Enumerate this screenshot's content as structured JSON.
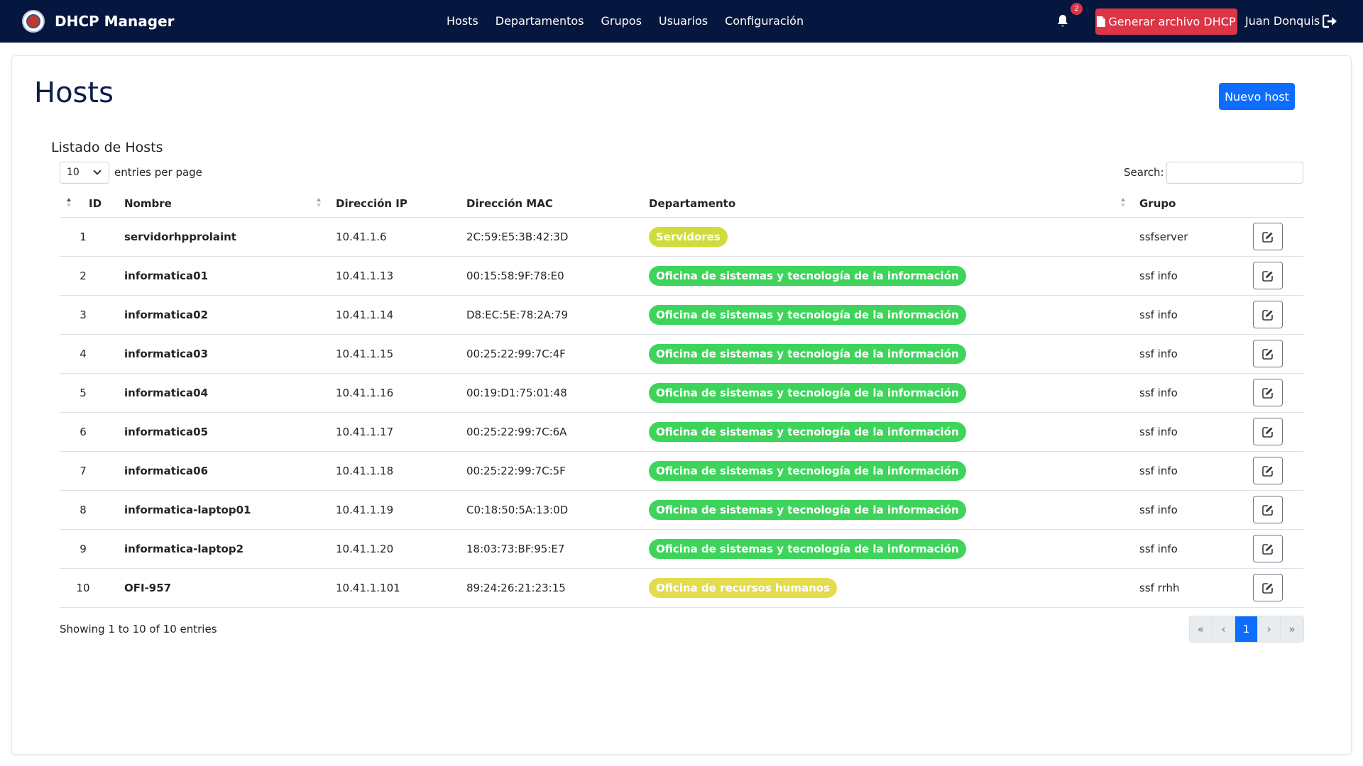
{
  "navbar": {
    "brand": "DHCP Manager",
    "links": [
      "Hosts",
      "Departamentos",
      "Grupos",
      "Usuarios",
      "Configuración"
    ],
    "notifications": "2",
    "generate_button": "Generar archivo DHCP",
    "user_name": "Juan Donquis"
  },
  "page": {
    "title": "Hosts",
    "new_host_button": "Nuevo host",
    "subtitle": "Listado de Hosts"
  },
  "table_controls": {
    "per_page_value": "10",
    "per_page_label": "entries per page",
    "search_label": "Search:",
    "search_value": ""
  },
  "table": {
    "headers": [
      "ID",
      "Nombre",
      "Dirección IP",
      "Dirección MAC",
      "Departamento",
      "Grupo"
    ],
    "rows": [
      {
        "id": "1",
        "name": "servidorhpprolaint",
        "ip": "10.41.1.6",
        "mac": "2C:59:E5:3B:42:3D",
        "dept": "Servidores",
        "dept_color": "#cfdc3c",
        "group": "ssfserver"
      },
      {
        "id": "2",
        "name": "informatica01",
        "ip": "10.41.1.13",
        "mac": "00:15:58:9F:78:E0",
        "dept": "Oficina de sistemas y tecnología de la información",
        "dept_color": "#3ed45c",
        "group": "ssf info"
      },
      {
        "id": "3",
        "name": "informatica02",
        "ip": "10.41.1.14",
        "mac": "D8:EC:5E:78:2A:79",
        "dept": "Oficina de sistemas y tecnología de la información",
        "dept_color": "#3ed45c",
        "group": "ssf info"
      },
      {
        "id": "4",
        "name": "informatica03",
        "ip": "10.41.1.15",
        "mac": "00:25:22:99:7C:4F",
        "dept": "Oficina de sistemas y tecnología de la información",
        "dept_color": "#3ed45c",
        "group": "ssf info"
      },
      {
        "id": "5",
        "name": "informatica04",
        "ip": "10.41.1.16",
        "mac": "00:19:D1:75:01:48",
        "dept": "Oficina de sistemas y tecnología de la información",
        "dept_color": "#3ed45c",
        "group": "ssf info"
      },
      {
        "id": "6",
        "name": "informatica05",
        "ip": "10.41.1.17",
        "mac": "00:25:22:99:7C:6A",
        "dept": "Oficina de sistemas y tecnología de la información",
        "dept_color": "#3ed45c",
        "group": "ssf info"
      },
      {
        "id": "7",
        "name": "informatica06",
        "ip": "10.41.1.18",
        "mac": "00:25:22:99:7C:5F",
        "dept": "Oficina de sistemas y tecnología de la información",
        "dept_color": "#3ed45c",
        "group": "ssf info"
      },
      {
        "id": "8",
        "name": "informatica-laptop01",
        "ip": "10.41.1.19",
        "mac": "C0:18:50:5A:13:0D",
        "dept": "Oficina de sistemas y tecnología de la información",
        "dept_color": "#3ed45c",
        "group": "ssf info"
      },
      {
        "id": "9",
        "name": "informatica-laptop2",
        "ip": "10.41.1.20",
        "mac": "18:03:73:BF:95:E7",
        "dept": "Oficina de sistemas y tecnología de la información",
        "dept_color": "#3ed45c",
        "group": "ssf info"
      },
      {
        "id": "10",
        "name": "OFI-957",
        "ip": "10.41.1.101",
        "mac": "89:24:26:21:23:15",
        "dept": "Oficina de recursos humanos",
        "dept_color": "#e2dc4e",
        "group": "ssf rrhh"
      }
    ]
  },
  "footer": {
    "showing": "Showing 1 to 10 of 10 entries",
    "pagination": [
      "«",
      "‹",
      "1",
      "›",
      "»"
    ],
    "active_page": "1"
  },
  "colors": {
    "navbar_bg": "#06173f",
    "danger": "#dc3545",
    "primary": "#0d6efd"
  },
  "icons": [
    "bell-icon",
    "file-icon",
    "logout-icon",
    "edit-icon",
    "sort-icon",
    "chevron-down-icon"
  ]
}
